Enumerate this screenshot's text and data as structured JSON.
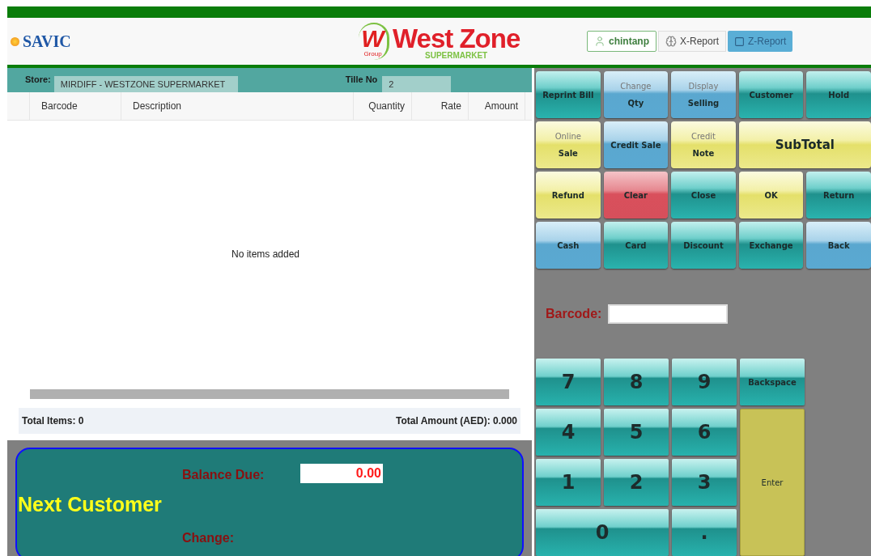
{
  "header": {
    "brand": "SAVIC",
    "logo": {
      "mark": "W",
      "group": "Group",
      "name": "West Zone",
      "tagline": "SUPERMARKET"
    },
    "buttons": [
      {
        "label": "chintanp",
        "kind": "user"
      },
      {
        "label": "X-Report",
        "kind": "plain"
      },
      {
        "label": "Z-Report",
        "kind": "primary"
      }
    ]
  },
  "store_bar": {
    "store_label": "Store:",
    "store": "MIRDIFF - WESTZONE SUPERMARKET",
    "till_label": "Tille No",
    "till": "2"
  },
  "table": {
    "columns": [
      "Barcode",
      "Description",
      "Quantity",
      "Rate",
      "Amount"
    ],
    "empty_message": "No items added"
  },
  "totals": {
    "items": "Total Items: 0",
    "amount": "Total Amount (AED): 0.000"
  },
  "balance": {
    "message": "Next Customer",
    "due_label": "Balance Due:",
    "due_value": "0.00",
    "change_label": "Change:"
  },
  "function_buttons": [
    {
      "label": "Reprint Bill",
      "kind": "teal"
    },
    {
      "top": "Change",
      "label": "Qty",
      "kind": "blue"
    },
    {
      "top": "Display",
      "label": "Selling",
      "kind": "blue"
    },
    {
      "label": "Customer",
      "kind": "teal"
    },
    {
      "label": "Hold",
      "kind": "teal"
    },
    {
      "top": "Online",
      "label": "Sale",
      "kind": "yellow"
    },
    {
      "label": "Credit Sale",
      "kind": "blue"
    },
    {
      "top": "Credit",
      "label": "Note",
      "kind": "yellow"
    },
    {
      "label": "SubTotal",
      "kind": "yellow",
      "wide": true
    },
    {
      "label": "Refund",
      "kind": "yellow"
    },
    {
      "label": "Clear",
      "kind": "red"
    },
    {
      "label": "Close",
      "kind": "teal"
    },
    {
      "label": "OK",
      "kind": "yellow"
    },
    {
      "label": "Return",
      "kind": "teal"
    },
    {
      "label": "Cash",
      "kind": "blue"
    },
    {
      "label": "Card",
      "kind": "teal"
    },
    {
      "label": "Discount",
      "kind": "teal"
    },
    {
      "label": "Exchange",
      "kind": "teal"
    },
    {
      "label": "Back",
      "kind": "blue"
    }
  ],
  "barcode": {
    "label": "Barcode:"
  },
  "keypad": [
    {
      "label": "7",
      "kind": "digit"
    },
    {
      "label": "8",
      "kind": "digit"
    },
    {
      "label": "9",
      "kind": "digit"
    },
    {
      "label": "Backspace",
      "kind": "action"
    },
    {
      "label": "4",
      "kind": "digit"
    },
    {
      "label": "5",
      "kind": "digit"
    },
    {
      "label": "6",
      "kind": "digit"
    },
    {
      "label": "1",
      "kind": "digit"
    },
    {
      "label": "2",
      "kind": "digit"
    },
    {
      "label": "3",
      "kind": "digit"
    },
    {
      "label": "Enter",
      "kind": "enter"
    },
    {
      "label": "0",
      "kind": "zero"
    },
    {
      "label": ".",
      "kind": "digit"
    }
  ]
}
